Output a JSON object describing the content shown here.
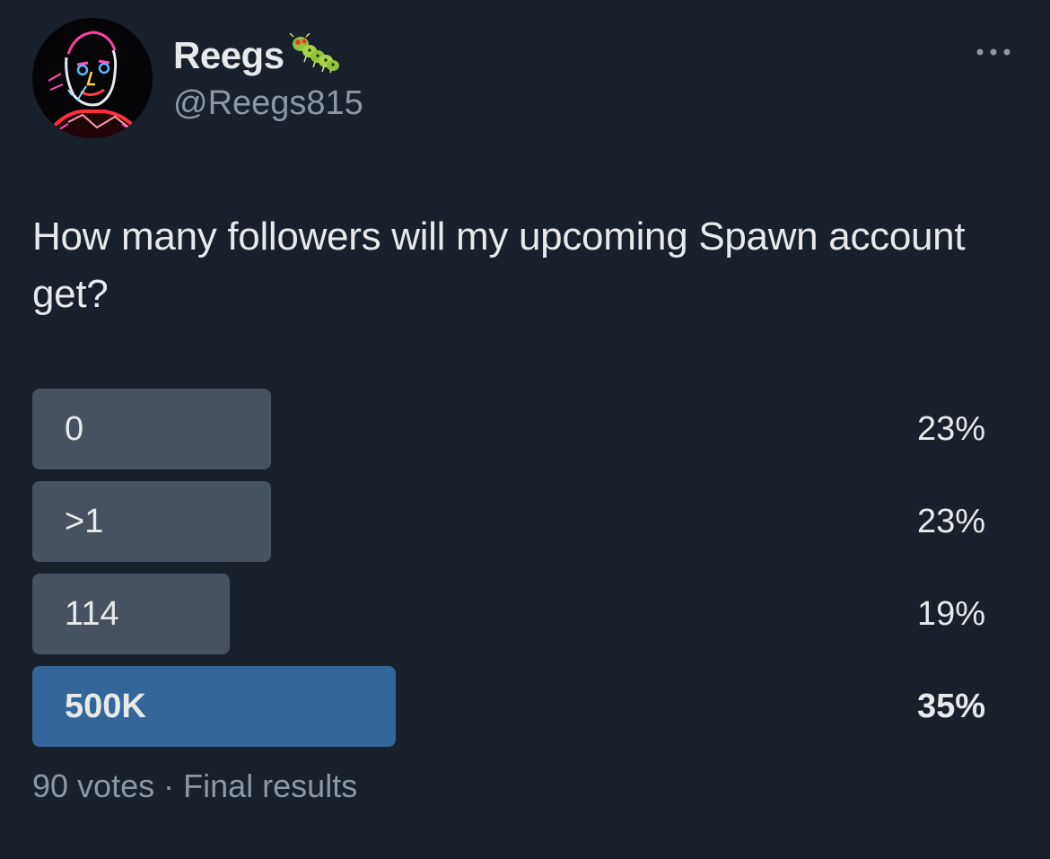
{
  "author": {
    "display_name": "Reegs",
    "handle": "@Reegs815",
    "name_emoji_icon": "caterpillar-icon",
    "avatar_icon": "neon-face-avatar"
  },
  "tweet": {
    "text": "How many followers will my upcoming Spawn account get?"
  },
  "poll": {
    "options": [
      {
        "label": "0",
        "percent_text": "23%",
        "percent": 23,
        "winner": false
      },
      {
        "label": ">1",
        "percent_text": "23%",
        "percent": 23,
        "winner": false
      },
      {
        "label": "114",
        "percent_text": "19%",
        "percent": 19,
        "winner": false
      },
      {
        "label": "500K",
        "percent_text": "35%",
        "percent": 35,
        "winner": true
      }
    ],
    "votes": "90 votes",
    "separator": "·",
    "status": "Final results"
  },
  "colors": {
    "background": "#18202b",
    "bar": "#46525f",
    "winner_bar": "#336699",
    "secondary_text": "#8b98a5"
  },
  "more_icon": "more-horizontal-icon"
}
